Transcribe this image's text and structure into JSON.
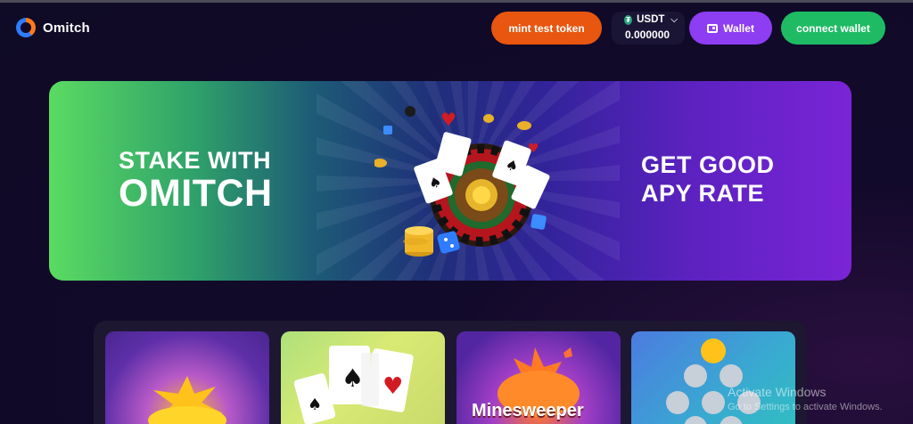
{
  "brand": {
    "name": "Omitch"
  },
  "header": {
    "mint_label": "mint test token",
    "token_symbol": "USDT",
    "token_icon": "tether-icon",
    "balance": "0.000000",
    "wallet_label": "Wallet",
    "connect_label": "connect wallet"
  },
  "banner": {
    "left_line1": "STAKE WITH",
    "left_line2": "OMITCH",
    "right_line1": "GET GOOD",
    "right_line2": "APY RATE"
  },
  "games": [
    {
      "title": ""
    },
    {
      "title": ""
    },
    {
      "title": "Minesweeper"
    },
    {
      "title": ""
    }
  ],
  "os_watermark": {
    "title": "Activate Windows",
    "subtitle": "Go to Settings to activate Windows."
  },
  "colors": {
    "mint": "#e8560f",
    "wallet": "#8d3df2",
    "connect": "#1fbb64",
    "background": "#120a2a"
  }
}
